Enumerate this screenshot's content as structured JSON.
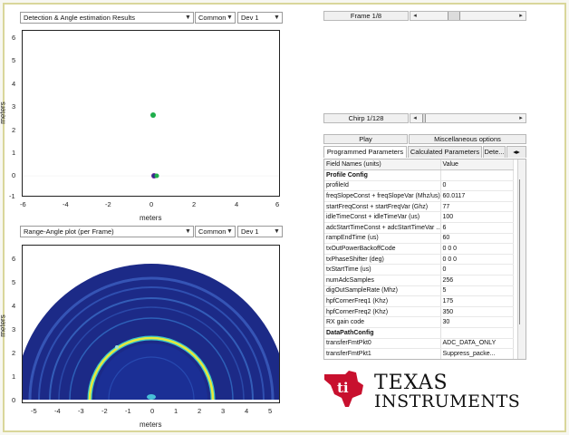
{
  "top_panel": {
    "plot_select": "Detection & Angle estimation Results",
    "view_select": "Common",
    "device_select": "Dev 1",
    "x_ticks": [
      "-6",
      "-4",
      "-2",
      "0",
      "2",
      "4",
      "6"
    ],
    "y_ticks": [
      "6",
      "5",
      "4",
      "3",
      "2",
      "1",
      "0",
      "-1"
    ],
    "xlabel": "meters",
    "ylabel": "meters"
  },
  "bottom_panel": {
    "plot_select": "Range-Angle plot (per Frame)",
    "view_select": "Common",
    "device_select": "Dev 1",
    "x_ticks": [
      "-5",
      "-4",
      "-3",
      "-2",
      "-1",
      "0",
      "1",
      "2",
      "3",
      "4",
      "5"
    ],
    "y_ticks": [
      "6",
      "5",
      "4",
      "3",
      "2",
      "1",
      "0"
    ],
    "xlabel": "meters",
    "ylabel": "meters"
  },
  "controls": {
    "frame_label": "Frame 1/8",
    "frame_value": 0.33,
    "chirp_label": "Chirp 1/128",
    "chirp_value": 0.03,
    "play_label": "Play",
    "misc_label": "Miscellaneous options"
  },
  "tabs": [
    "Programmed Parameters",
    "Calculated Parameters",
    "Dete..."
  ],
  "param_table": {
    "headers": [
      "Field Names    (units)",
      "Value"
    ],
    "rows": [
      {
        "name": "Profile Config",
        "value": "",
        "section": true
      },
      {
        "name": "profileId",
        "value": "0"
      },
      {
        "name": "freqSlopeConst + freqSlopeVar (Mhz/us)",
        "value": "60.0117"
      },
      {
        "name": "startFreqConst + startFreqVar (Ghz)",
        "value": "77"
      },
      {
        "name": "idleTimeConst + idleTimeVar (us)",
        "value": "100"
      },
      {
        "name": "adcStartTimeConst + adcStartTimeVar ...",
        "value": "6"
      },
      {
        "name": "rampEndTime (us)",
        "value": "60"
      },
      {
        "name": "txOutPowerBackoffCode",
        "value": "0 0 0"
      },
      {
        "name": "txPhaseShifter (deg)",
        "value": "0 0 0"
      },
      {
        "name": "txStartTime (us)",
        "value": "0"
      },
      {
        "name": "numAdcSamples",
        "value": "256"
      },
      {
        "name": "digOutSampleRate (Mhz)",
        "value": "5"
      },
      {
        "name": "hpfCornerFreq1 (Khz)",
        "value": "175"
      },
      {
        "name": "hpfCornerFreq2 (Khz)",
        "value": "350"
      },
      {
        "name": "RX gain code",
        "value": "30"
      },
      {
        "name": "DataPathConfig",
        "value": "",
        "section": true
      },
      {
        "name": "transferFmtPkt0",
        "value": "ADC_DATA_ONLY"
      },
      {
        "name": "transferFmtPkt1",
        "value": "Suppress_packe..."
      }
    ]
  },
  "logo": {
    "line1": "Texas",
    "line2": "Instruments",
    "color": "#c8102e"
  },
  "colors": {
    "green_point": "#1fae4b",
    "purple_point": "#6a2d9a",
    "ring_yellow": "#e8e93a",
    "ring_cyan": "#39c6c9",
    "bg_blue": "#1a2e8f"
  }
}
